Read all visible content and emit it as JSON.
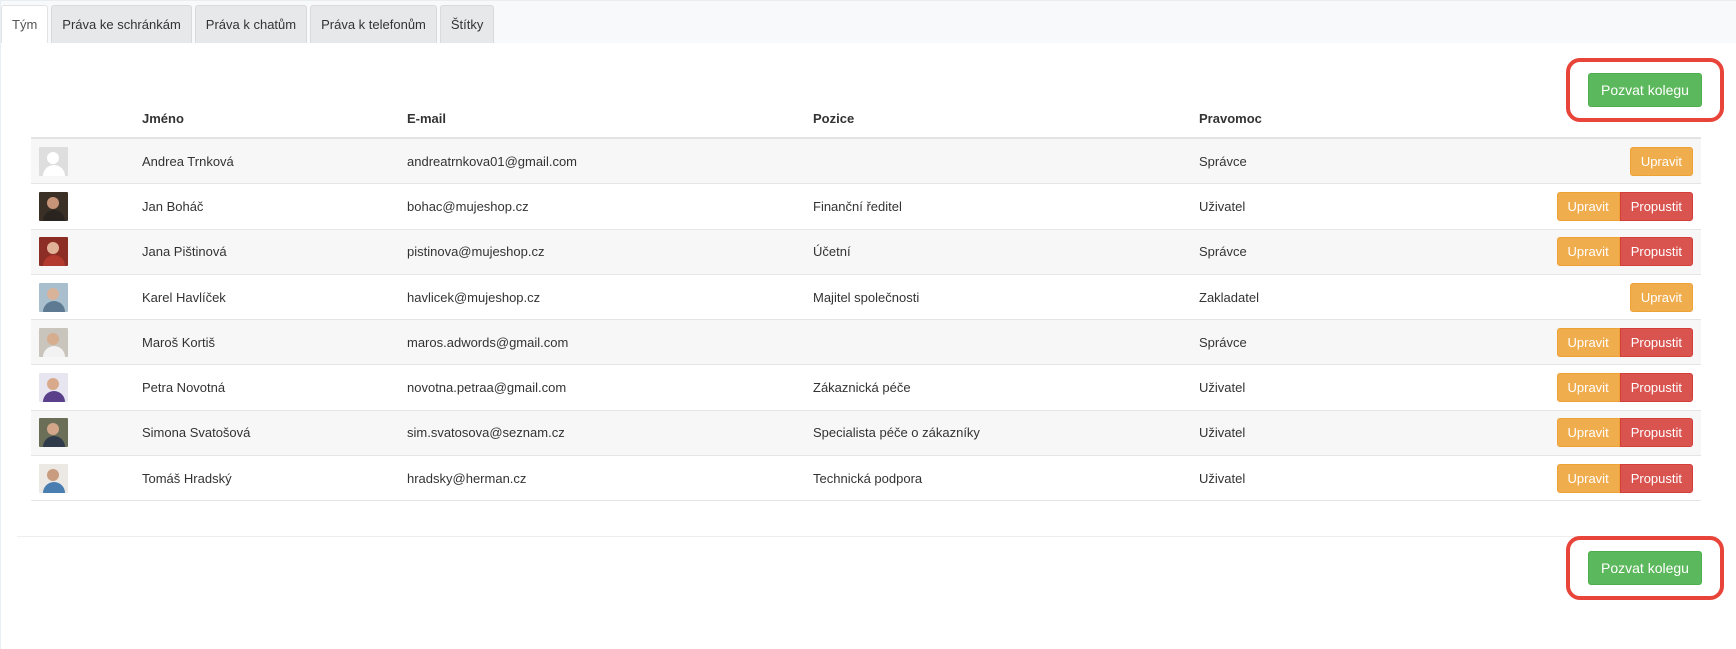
{
  "tabs": [
    "Tým",
    "Práva ke schránkám",
    "Práva k chatům",
    "Práva k telefonům",
    "Štítky"
  ],
  "active_tab": "Tým",
  "invite_label": "Pozvat kolegu",
  "columns": {
    "name": "Jméno",
    "email": "E-mail",
    "position": "Pozice",
    "role": "Pravomoc"
  },
  "edit_label": "Upravit",
  "fire_label": "Propustit",
  "colors": {
    "edit": "#f0ad4e",
    "fire": "#d9534f",
    "invite": "#5cb85c",
    "highlight": "#e8443a"
  },
  "members": [
    {
      "name": "Andrea Trnková",
      "email": "andreatrnkova01@gmail.com",
      "position": "",
      "role": "Správce",
      "can_fire": false,
      "avatar": {
        "bg": "#dedede",
        "skin": "#ffffff",
        "shirt": "#ffffff"
      }
    },
    {
      "name": "Jan Boháč",
      "email": "bohac@mujeshop.cz",
      "position": "Finanční ředitel",
      "role": "Uživatel",
      "can_fire": true,
      "avatar": {
        "bg": "#3b3026",
        "skin": "#c89478",
        "shirt": "#2a2420"
      }
    },
    {
      "name": "Jana Pištinová",
      "email": "pistinova@mujeshop.cz",
      "position": "Účetní",
      "role": "Správce",
      "can_fire": true,
      "avatar": {
        "bg": "#8c2e25",
        "skin": "#e2b298",
        "shirt": "#b33a2e"
      }
    },
    {
      "name": "Karel Havlíček",
      "email": "havlicek@mujeshop.cz",
      "position": "Majitel společnosti",
      "role": "Zakladatel",
      "can_fire": false,
      "avatar": {
        "bg": "#a9bfcd",
        "skin": "#d8b39a",
        "shirt": "#5d7a92"
      }
    },
    {
      "name": "Maroš Kortiš",
      "email": "maros.adwords@gmail.com",
      "position": "",
      "role": "Správce",
      "can_fire": true,
      "avatar": {
        "bg": "#c9c4bc",
        "skin": "#d7ad90",
        "shirt": "#f2f2f2"
      }
    },
    {
      "name": "Petra Novotná",
      "email": "novotna.petraa@gmail.com",
      "position": "Zákaznická péče",
      "role": "Uživatel",
      "can_fire": true,
      "avatar": {
        "bg": "#e7e5f0",
        "skin": "#d9a98c",
        "shirt": "#5a3f8a"
      }
    },
    {
      "name": "Simona Svatošová",
      "email": "sim.svatosova@seznam.cz",
      "position": "Specialista péče o zákazníky",
      "role": "Uživatel",
      "can_fire": true,
      "avatar": {
        "bg": "#6b6f58",
        "skin": "#d3a68a",
        "shirt": "#2f3a4a"
      }
    },
    {
      "name": "Tomáš Hradský",
      "email": "hradsky@herman.cz",
      "position": "Technická podpora",
      "role": "Uživatel",
      "can_fire": true,
      "avatar": {
        "bg": "#ece9e4",
        "skin": "#c99c80",
        "shirt": "#4a7db0"
      }
    }
  ]
}
